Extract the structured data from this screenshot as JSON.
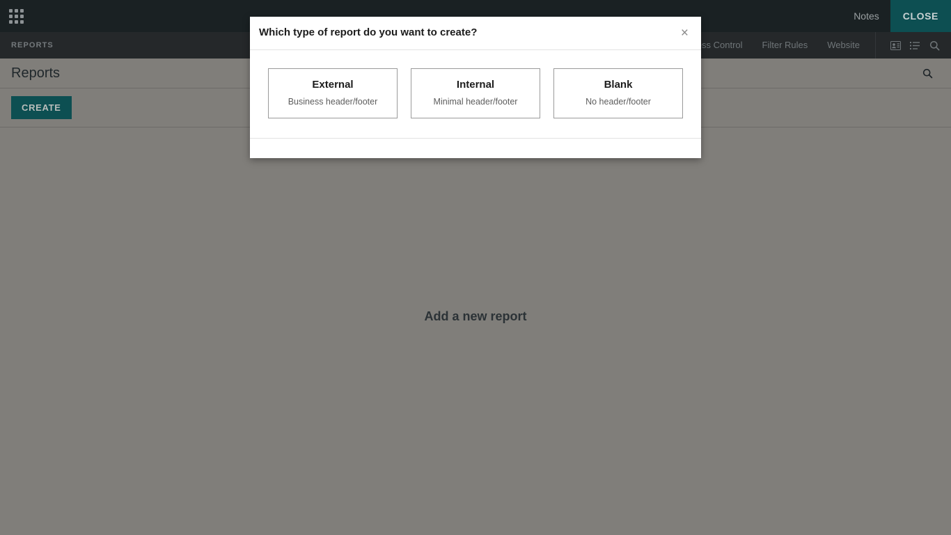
{
  "topbar": {
    "app_grid_icon": "apps-grid-icon",
    "nav_items": [
      {
        "label": "Notes"
      }
    ],
    "close_label": "CLOSE"
  },
  "subnav": {
    "brand": "REPORTS",
    "links": [
      {
        "label": "Access Control"
      },
      {
        "label": "Filter Rules"
      },
      {
        "label": "Website"
      }
    ],
    "icons": [
      {
        "name": "contact-card-icon"
      },
      {
        "name": "list-icon"
      },
      {
        "name": "search-icon"
      }
    ]
  },
  "content": {
    "page_title": "Reports",
    "search_icon": "search-icon",
    "create_label": "CREATE",
    "empty_state_text": "Add a new report"
  },
  "modal": {
    "title": "Which type of report do you want to create?",
    "close_glyph": "×",
    "options": [
      {
        "title": "External",
        "subtitle": "Business header/footer"
      },
      {
        "title": "Internal",
        "subtitle": "Minimal header/footer"
      },
      {
        "title": "Blank",
        "subtitle": "No header/footer"
      }
    ]
  },
  "colors": {
    "topbar_bg": "#1a2123",
    "subnav_bg": "#25282a",
    "accent_teal": "#0d4f52",
    "overlay_gray": "#807e7a",
    "modal_bg": "#ffffff"
  }
}
